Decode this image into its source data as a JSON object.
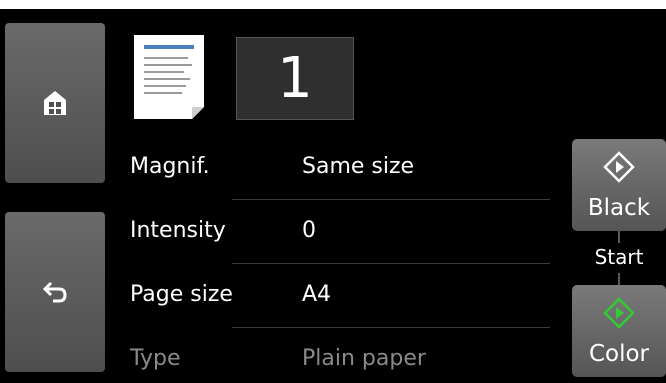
{
  "home": {
    "icon": "home-icon"
  },
  "back": {
    "icon": "back-arrow-icon"
  },
  "document": {
    "icon": "document-icon"
  },
  "copies": {
    "value": "1"
  },
  "settings": [
    {
      "label": "Magnif.",
      "value": "Same size"
    },
    {
      "label": "Intensity",
      "value": "0"
    },
    {
      "label": "Page size",
      "value": "A4"
    },
    {
      "label": "Type",
      "value": "Plain paper"
    }
  ],
  "start": {
    "label": "Start",
    "black_label": "Black",
    "color_label": "Color",
    "icon": "start-diamond-icon",
    "black_icon_color": "#ffffff",
    "color_icon_color": "#33cc33"
  },
  "colors": {
    "background": "#000000",
    "button": "#5e5e5e",
    "text": "#ffffff"
  }
}
